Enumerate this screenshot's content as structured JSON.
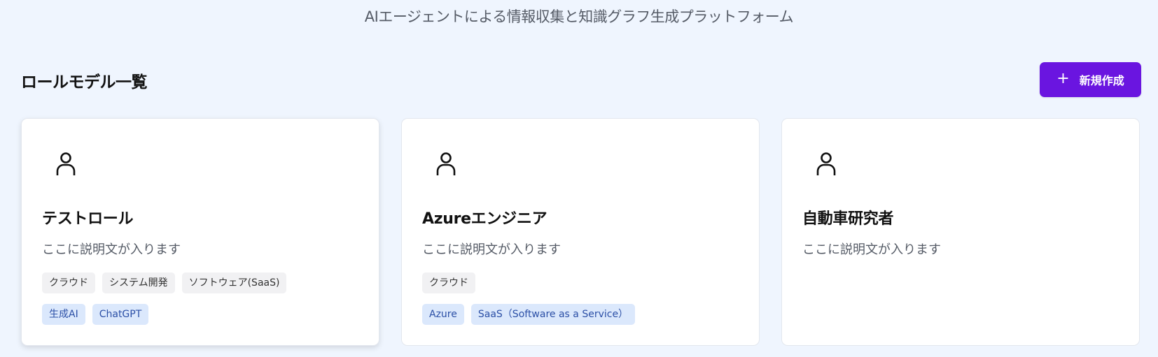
{
  "header": {
    "subtitle": "AIエージェントによる情報収集と知識グラフ生成プラットフォーム"
  },
  "section": {
    "title": "ロールモデル一覧"
  },
  "actions": {
    "new_icon": "+",
    "new_label": "新規作成"
  },
  "cards": [
    {
      "icon": "person-icon",
      "name": "テストロール",
      "description": "ここに説明文が入ります",
      "tags_primary": [
        "クラウド",
        "システム開発",
        "ソフトウェア(SaaS)"
      ],
      "tags_secondary": [
        "生成AI",
        "ChatGPT"
      ]
    },
    {
      "icon": "person-icon",
      "name": "Azureエンジニア",
      "description": "ここに説明文が入ります",
      "tags_primary": [
        "クラウド"
      ],
      "tags_secondary": [
        "Azure",
        "SaaS（Software as a Service）"
      ]
    },
    {
      "icon": "person-icon",
      "name": "自動車研究者",
      "description": "ここに説明文が入ります",
      "tags_primary": [],
      "tags_secondary": []
    }
  ],
  "colors": {
    "background": "#eff5fe",
    "accent": "#6a15e0",
    "tag_gray_bg": "#f1f1f3",
    "tag_blue_bg": "#dbe8fc",
    "tag_blue_text": "#2b4fa6"
  }
}
